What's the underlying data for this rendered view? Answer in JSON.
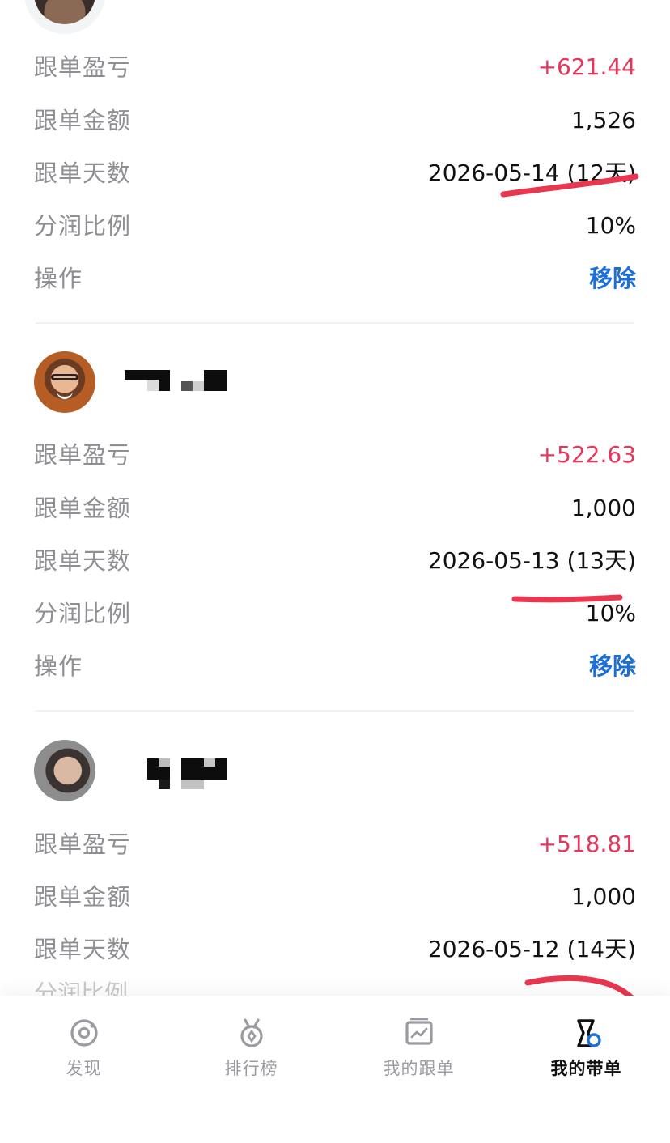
{
  "cards": [
    {
      "rows": [
        {
          "label": "跟单盈亏",
          "value": "+621.44"
        },
        {
          "label": "跟单金额",
          "value": "1,526"
        },
        {
          "label": "跟单天数",
          "value": "2026-05-14 (12天)"
        },
        {
          "label": "分润比例",
          "value": "10%"
        },
        {
          "label": "操作",
          "value": "移除"
        }
      ]
    },
    {
      "rows": [
        {
          "label": "跟单盈亏",
          "value": "+522.63"
        },
        {
          "label": "跟单金额",
          "value": "1,000"
        },
        {
          "label": "跟单天数",
          "value": "2026-05-13 (13天)"
        },
        {
          "label": "分润比例",
          "value": "10%"
        },
        {
          "label": "操作",
          "value": "移除"
        }
      ]
    },
    {
      "rows": [
        {
          "label": "跟单盈亏",
          "value": "+518.81"
        },
        {
          "label": "跟单金额",
          "value": "1,000"
        },
        {
          "label": "跟单天数",
          "value": "2026-05-12 (14天)"
        }
      ],
      "partial_label": "分润比例"
    }
  ],
  "tabbar": {
    "tabs": [
      {
        "label": "发现",
        "icon": "discover-icon"
      },
      {
        "label": "排行榜",
        "icon": "medal-icon"
      },
      {
        "label": "我的跟单",
        "icon": "chart-board-icon"
      },
      {
        "label": "我的带单",
        "icon": "lead-trader-icon"
      }
    ],
    "active_index": 3
  },
  "colors": {
    "profit": "#e8365b",
    "action": "#1b6fd6",
    "label": "#8e8e93",
    "annotation": "#e8374f"
  }
}
